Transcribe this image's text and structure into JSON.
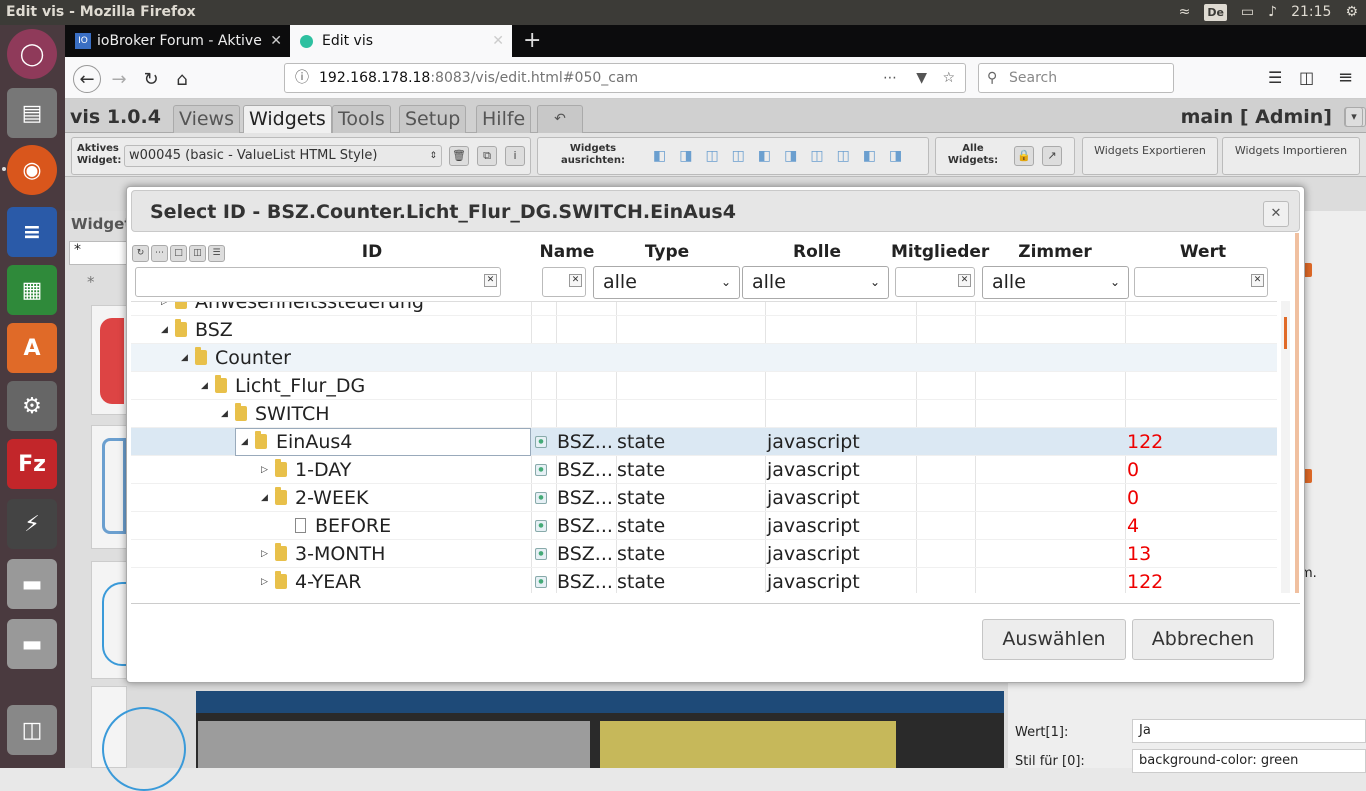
{
  "window": {
    "title": "Edit vis - Mozilla Firefox"
  },
  "tray": {
    "keyboard": "De",
    "time": "21:15"
  },
  "browser": {
    "tabs": [
      {
        "label": "ioBroker Forum - Aktive",
        "active": false
      },
      {
        "label": "Edit vis",
        "active": true
      }
    ],
    "url_host": "192.168.178.18",
    "url_rest": ":8083/vis/edit.html#050_cam",
    "search_placeholder": "Search"
  },
  "app": {
    "version": "vis 1.0.4",
    "menu": [
      "Views",
      "Widgets",
      "Tools",
      "Setup",
      "Hilfe"
    ],
    "user": "main [  Admin]",
    "toolbar": {
      "active_widget_label": "Aktives Widget:",
      "active_widget_value": "w00045 (basic - ValueList HTML Style)",
      "align_label": "Widgets ausrichten:",
      "all_widgets_label": "Alle Widgets:",
      "export_label": "Widgets Exportieren",
      "import_label": "Widgets Importieren"
    },
    "sidebar_label": "Widget",
    "sidebar_filter": "*",
    "right_panel": {
      "wert1_label": "Wert[1]:",
      "wert1_value": "Ja",
      "stil_label": "Stil für [0]:",
      "stil_value": "background-color: green",
      "snip": "m."
    }
  },
  "dialog": {
    "title": "Select ID - BSZ.Counter.Licht_Flur_DG.SWITCH.EinAus4",
    "columns": [
      "ID",
      "Name",
      "Type",
      "Rolle",
      "Mitglieder",
      "Zimmer",
      "Wert"
    ],
    "filters": {
      "type": "alle",
      "rolle": "alle",
      "zimmer": "alle"
    },
    "rows": [
      {
        "label": "Anwesenheitssteuerung",
        "indent": 0,
        "kind": "folder",
        "expand": "closed"
      },
      {
        "label": "BSZ",
        "indent": 0,
        "kind": "folder",
        "expand": "open"
      },
      {
        "label": "Counter",
        "indent": 1,
        "kind": "folder",
        "expand": "open"
      },
      {
        "label": "Licht_Flur_DG",
        "indent": 2,
        "kind": "folder",
        "expand": "open"
      },
      {
        "label": "SWITCH",
        "indent": 3,
        "kind": "folder",
        "expand": "open"
      },
      {
        "label": "EinAus4",
        "indent": 4,
        "kind": "folder",
        "expand": "open",
        "name": "BSZ...",
        "type": "state",
        "role": "javascript",
        "value": "122"
      },
      {
        "label": "1-DAY",
        "indent": 5,
        "kind": "folder",
        "expand": "closed",
        "name": "BSZ...",
        "type": "state",
        "role": "javascript",
        "value": "0"
      },
      {
        "label": "2-WEEK",
        "indent": 5,
        "kind": "folder",
        "expand": "open",
        "name": "BSZ...",
        "type": "state",
        "role": "javascript",
        "value": "0"
      },
      {
        "label": "BEFORE",
        "indent": 6,
        "kind": "file",
        "expand": "none",
        "name": "BSZ...",
        "type": "state",
        "role": "javascript",
        "value": "4"
      },
      {
        "label": "3-MONTH",
        "indent": 5,
        "kind": "folder",
        "expand": "closed",
        "name": "BSZ...",
        "type": "state",
        "role": "javascript",
        "value": "13"
      },
      {
        "label": "4-YEAR",
        "indent": 5,
        "kind": "folder",
        "expand": "closed",
        "name": "BSZ...",
        "type": "state",
        "role": "javascript",
        "value": "122"
      }
    ],
    "select_label": "Auswählen",
    "cancel_label": "Abbrechen"
  }
}
